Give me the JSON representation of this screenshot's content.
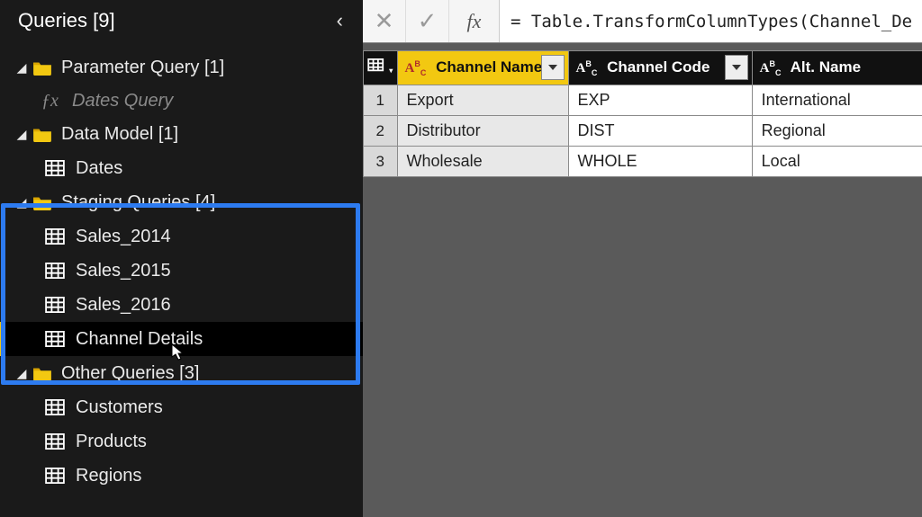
{
  "sidebar": {
    "title": "Queries [9]",
    "groups": [
      {
        "label": "Parameter Query [1]",
        "fx_item": "Dates Query",
        "items": []
      },
      {
        "label": "Data Model [1]",
        "items": [
          {
            "label": "Dates"
          }
        ]
      },
      {
        "label": "Staging Queries [4]",
        "items": [
          {
            "label": "Sales_2014"
          },
          {
            "label": "Sales_2015"
          },
          {
            "label": "Sales_2016"
          },
          {
            "label": "Channel Details",
            "selected": true
          }
        ]
      },
      {
        "label": "Other Queries [3]",
        "items": [
          {
            "label": "Customers"
          },
          {
            "label": "Products"
          },
          {
            "label": "Regions"
          }
        ]
      }
    ]
  },
  "formula_bar": {
    "fx": "fx",
    "value": "= Table.TransformColumnTypes(Channel_Deta"
  },
  "grid": {
    "columns": [
      {
        "name": "Channel Name",
        "selected": true
      },
      {
        "name": "Channel Code"
      },
      {
        "name": "Alt. Name"
      }
    ],
    "rows": [
      {
        "num": "1",
        "cells": [
          "Export",
          "EXP",
          "International"
        ]
      },
      {
        "num": "2",
        "cells": [
          "Distributor",
          "DIST",
          "Regional"
        ]
      },
      {
        "num": "3",
        "cells": [
          "Wholesale",
          "WHOLE",
          "Local"
        ]
      }
    ]
  }
}
